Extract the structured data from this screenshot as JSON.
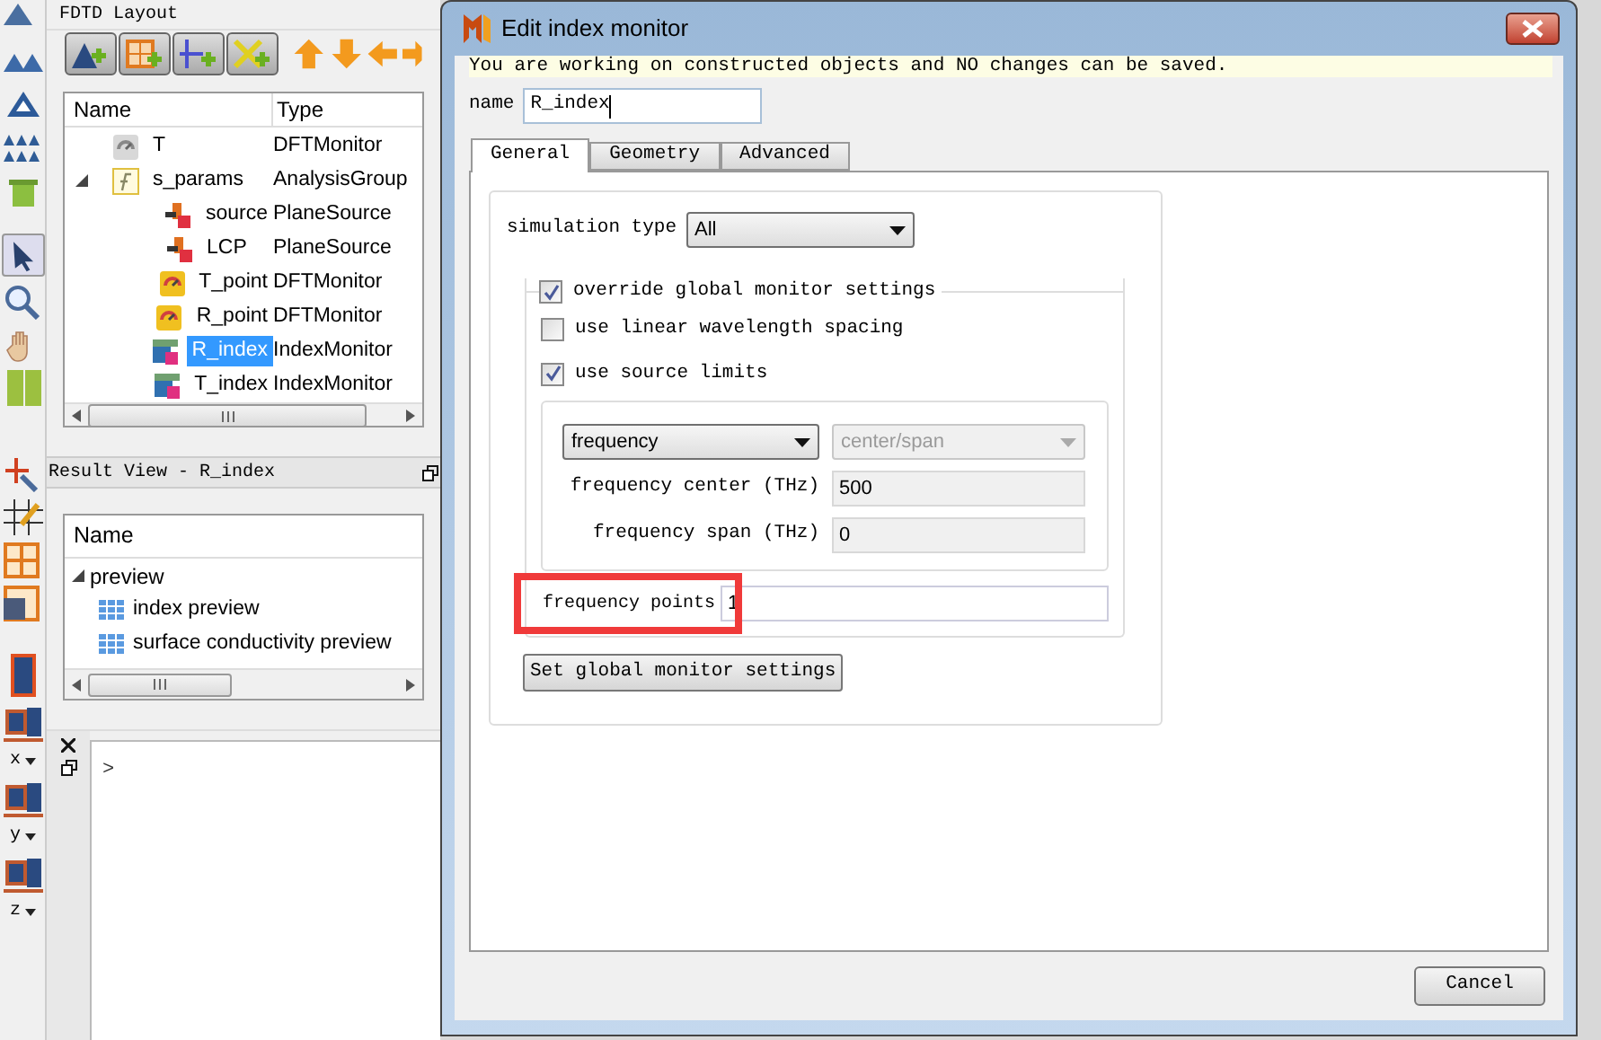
{
  "side_toolbar": {
    "axis_labels": [
      "x",
      "y",
      "z"
    ]
  },
  "layout_panel": {
    "title": "FDTD Layout",
    "columns": [
      "Name",
      "Type"
    ],
    "rows": [
      {
        "name": "T",
        "type": "DFTMonitor",
        "kind": "monitor",
        "selected": false
      },
      {
        "name": "s_params",
        "type": "AnalysisGroup",
        "kind": "group",
        "selected": false,
        "expanded": true,
        "children": [
          {
            "name": "source",
            "type": "PlaneSource",
            "kind": "source",
            "selected": false
          },
          {
            "name": "LCP",
            "type": "PlaneSource",
            "kind": "source",
            "selected": false
          },
          {
            "name": "T_point",
            "type": "DFTMonitor",
            "kind": "point",
            "selected": false
          },
          {
            "name": "R_point",
            "type": "DFTMonitor",
            "kind": "point",
            "selected": false
          },
          {
            "name": "R_index",
            "type": "IndexMonitor",
            "kind": "index",
            "selected": true
          },
          {
            "name": "T_index",
            "type": "IndexMonitor",
            "kind": "index",
            "selected": false
          }
        ]
      }
    ]
  },
  "result_view": {
    "title": "Result View - R_index",
    "columns": [
      "Name"
    ],
    "rows": [
      {
        "name": "preview",
        "expanded": true,
        "children": [
          {
            "name": "index preview"
          },
          {
            "name": "surface conductivity preview"
          }
        ]
      }
    ]
  },
  "console": {
    "prompt": ">"
  },
  "dialog": {
    "title": "Edit index monitor",
    "notice": "You are working on constructed objects and NO changes can be saved.",
    "name_label": "name",
    "name_value": "R_index",
    "tabs": [
      {
        "label": "General",
        "selected": true
      },
      {
        "label": "Geometry",
        "selected": false
      },
      {
        "label": "Advanced",
        "selected": false
      }
    ],
    "simulation_type_label": "simulation type",
    "simulation_type": "All",
    "override": {
      "label": "override global monitor settings",
      "checked": true
    },
    "options": [
      {
        "label": "use linear wavelength spacing",
        "checked": false
      },
      {
        "label": "use source limits",
        "checked": true
      }
    ],
    "range_mode": {
      "value": "frequency",
      "disabled": false
    },
    "range_style": {
      "value": "center/span",
      "disabled": true
    },
    "fields": [
      {
        "label": "frequency center (THz)",
        "value": "500",
        "disabled": true
      },
      {
        "label": "frequency span (THz)",
        "value": "0",
        "disabled": true
      }
    ],
    "frequency_points": {
      "label": "frequency points",
      "value": "1",
      "highlighted": true
    },
    "set_global_button": "Set global monitor settings",
    "cancel_button": "Cancel"
  }
}
